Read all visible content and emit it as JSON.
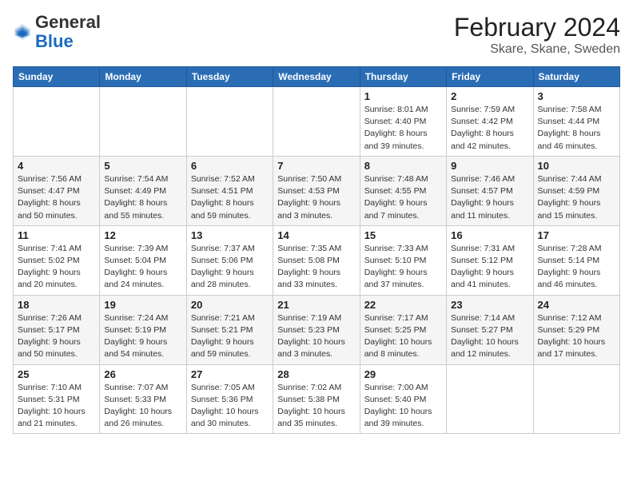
{
  "header": {
    "logo_general": "General",
    "logo_blue": "Blue",
    "month": "February 2024",
    "location": "Skare, Skane, Sweden"
  },
  "days_of_week": [
    "Sunday",
    "Monday",
    "Tuesday",
    "Wednesday",
    "Thursday",
    "Friday",
    "Saturday"
  ],
  "weeks": [
    [
      {
        "day": "",
        "info": ""
      },
      {
        "day": "",
        "info": ""
      },
      {
        "day": "",
        "info": ""
      },
      {
        "day": "",
        "info": ""
      },
      {
        "day": "1",
        "info": "Sunrise: 8:01 AM\nSunset: 4:40 PM\nDaylight: 8 hours\nand 39 minutes."
      },
      {
        "day": "2",
        "info": "Sunrise: 7:59 AM\nSunset: 4:42 PM\nDaylight: 8 hours\nand 42 minutes."
      },
      {
        "day": "3",
        "info": "Sunrise: 7:58 AM\nSunset: 4:44 PM\nDaylight: 8 hours\nand 46 minutes."
      }
    ],
    [
      {
        "day": "4",
        "info": "Sunrise: 7:56 AM\nSunset: 4:47 PM\nDaylight: 8 hours\nand 50 minutes."
      },
      {
        "day": "5",
        "info": "Sunrise: 7:54 AM\nSunset: 4:49 PM\nDaylight: 8 hours\nand 55 minutes."
      },
      {
        "day": "6",
        "info": "Sunrise: 7:52 AM\nSunset: 4:51 PM\nDaylight: 8 hours\nand 59 minutes."
      },
      {
        "day": "7",
        "info": "Sunrise: 7:50 AM\nSunset: 4:53 PM\nDaylight: 9 hours\nand 3 minutes."
      },
      {
        "day": "8",
        "info": "Sunrise: 7:48 AM\nSunset: 4:55 PM\nDaylight: 9 hours\nand 7 minutes."
      },
      {
        "day": "9",
        "info": "Sunrise: 7:46 AM\nSunset: 4:57 PM\nDaylight: 9 hours\nand 11 minutes."
      },
      {
        "day": "10",
        "info": "Sunrise: 7:44 AM\nSunset: 4:59 PM\nDaylight: 9 hours\nand 15 minutes."
      }
    ],
    [
      {
        "day": "11",
        "info": "Sunrise: 7:41 AM\nSunset: 5:02 PM\nDaylight: 9 hours\nand 20 minutes."
      },
      {
        "day": "12",
        "info": "Sunrise: 7:39 AM\nSunset: 5:04 PM\nDaylight: 9 hours\nand 24 minutes."
      },
      {
        "day": "13",
        "info": "Sunrise: 7:37 AM\nSunset: 5:06 PM\nDaylight: 9 hours\nand 28 minutes."
      },
      {
        "day": "14",
        "info": "Sunrise: 7:35 AM\nSunset: 5:08 PM\nDaylight: 9 hours\nand 33 minutes."
      },
      {
        "day": "15",
        "info": "Sunrise: 7:33 AM\nSunset: 5:10 PM\nDaylight: 9 hours\nand 37 minutes."
      },
      {
        "day": "16",
        "info": "Sunrise: 7:31 AM\nSunset: 5:12 PM\nDaylight: 9 hours\nand 41 minutes."
      },
      {
        "day": "17",
        "info": "Sunrise: 7:28 AM\nSunset: 5:14 PM\nDaylight: 9 hours\nand 46 minutes."
      }
    ],
    [
      {
        "day": "18",
        "info": "Sunrise: 7:26 AM\nSunset: 5:17 PM\nDaylight: 9 hours\nand 50 minutes."
      },
      {
        "day": "19",
        "info": "Sunrise: 7:24 AM\nSunset: 5:19 PM\nDaylight: 9 hours\nand 54 minutes."
      },
      {
        "day": "20",
        "info": "Sunrise: 7:21 AM\nSunset: 5:21 PM\nDaylight: 9 hours\nand 59 minutes."
      },
      {
        "day": "21",
        "info": "Sunrise: 7:19 AM\nSunset: 5:23 PM\nDaylight: 10 hours\nand 3 minutes."
      },
      {
        "day": "22",
        "info": "Sunrise: 7:17 AM\nSunset: 5:25 PM\nDaylight: 10 hours\nand 8 minutes."
      },
      {
        "day": "23",
        "info": "Sunrise: 7:14 AM\nSunset: 5:27 PM\nDaylight: 10 hours\nand 12 minutes."
      },
      {
        "day": "24",
        "info": "Sunrise: 7:12 AM\nSunset: 5:29 PM\nDaylight: 10 hours\nand 17 minutes."
      }
    ],
    [
      {
        "day": "25",
        "info": "Sunrise: 7:10 AM\nSunset: 5:31 PM\nDaylight: 10 hours\nand 21 minutes."
      },
      {
        "day": "26",
        "info": "Sunrise: 7:07 AM\nSunset: 5:33 PM\nDaylight: 10 hours\nand 26 minutes."
      },
      {
        "day": "27",
        "info": "Sunrise: 7:05 AM\nSunset: 5:36 PM\nDaylight: 10 hours\nand 30 minutes."
      },
      {
        "day": "28",
        "info": "Sunrise: 7:02 AM\nSunset: 5:38 PM\nDaylight: 10 hours\nand 35 minutes."
      },
      {
        "day": "29",
        "info": "Sunrise: 7:00 AM\nSunset: 5:40 PM\nDaylight: 10 hours\nand 39 minutes."
      },
      {
        "day": "",
        "info": ""
      },
      {
        "day": "",
        "info": ""
      }
    ]
  ]
}
